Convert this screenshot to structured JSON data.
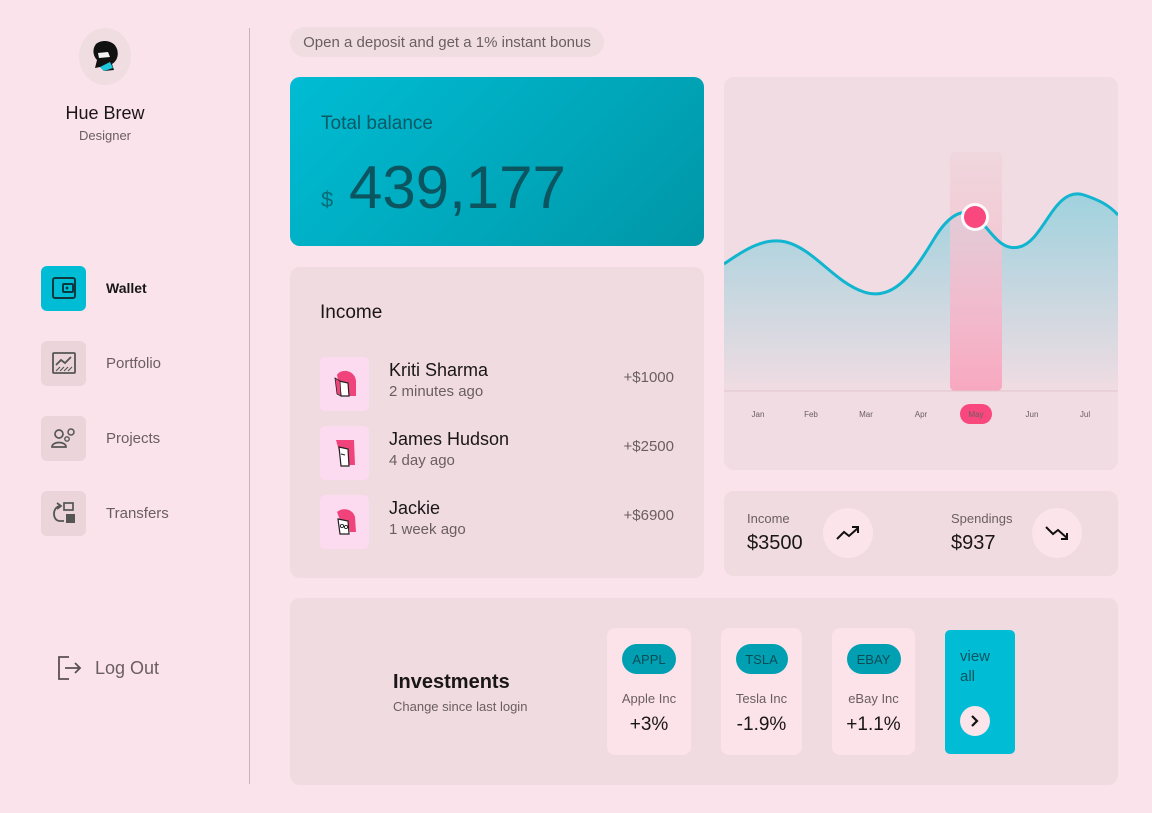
{
  "profile": {
    "name": "Hue Brew",
    "role": "Designer",
    "avatar_icon": "masked-person-avatar"
  },
  "nav": {
    "items": [
      {
        "label": "Wallet",
        "icon": "wallet-icon",
        "active": true
      },
      {
        "label": "Portfolio",
        "icon": "chart-icon",
        "active": false
      },
      {
        "label": "Projects",
        "icon": "team-settings-icon",
        "active": false
      },
      {
        "label": "Transfers",
        "icon": "transfer-icon",
        "active": false
      }
    ],
    "logout_label": "Log Out"
  },
  "banner": {
    "text": "Open a deposit and get a 1% instant bonus"
  },
  "balance": {
    "title": "Total balance",
    "currency": "$",
    "amount": "439,177"
  },
  "income": {
    "title": "Income",
    "rows": [
      {
        "name": "Kriti Sharma",
        "time": "2 minutes ago",
        "amount": "+$1000"
      },
      {
        "name": "James Hudson",
        "time": "4 day ago",
        "amount": "+$2500"
      },
      {
        "name": "Jackie",
        "time": "1 week ago",
        "amount": "+$6900"
      }
    ]
  },
  "chart_data": {
    "type": "area",
    "categories": [
      "Jan",
      "Feb",
      "Mar",
      "Apr",
      "May",
      "Jun",
      "Jul"
    ],
    "highlighted": "May",
    "grid": false,
    "legend": "none"
  },
  "stats": {
    "income_label": "Income",
    "income_value": "$3500",
    "income_icon": "trending-up-icon",
    "spendings_label": "Spendings",
    "spendings_value": "$937",
    "spendings_icon": "trending-down-icon"
  },
  "investments": {
    "title": "Investments",
    "subtitle": "Change since last login",
    "stocks": [
      {
        "ticker": "APPL",
        "name": "Apple Inc",
        "change": "+3%"
      },
      {
        "ticker": "TSLA",
        "name": "Tesla Inc",
        "change": "-1.9%"
      },
      {
        "ticker": "EBAY",
        "name": "eBay Inc",
        "change": "+1.1%"
      }
    ],
    "view_all_label": "view all"
  },
  "colors": {
    "background": "#fae3ea",
    "accent": "#00bcd4",
    "highlight": "#f8487e"
  }
}
